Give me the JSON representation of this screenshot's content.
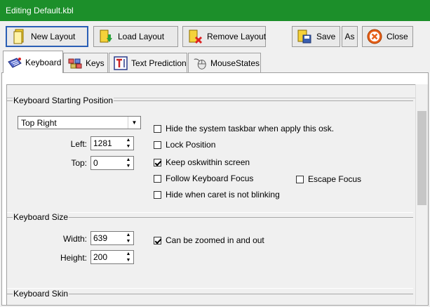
{
  "window": {
    "title": "Editing Default.kbl"
  },
  "toolbar": {
    "new_layout": "New Layout",
    "load_layout": "Load Layout",
    "remove_layout": "Remove Layout",
    "save": "Save",
    "save_as": "As",
    "close": "Close"
  },
  "tabs": [
    {
      "label": "Keyboard",
      "icon": "keyboard-icon",
      "selected": true
    },
    {
      "label": "Keys",
      "icon": "keys-icon",
      "selected": false
    },
    {
      "label": "Text Prediction",
      "icon": "text-prediction-icon",
      "selected": false
    },
    {
      "label": "MouseStates",
      "icon": "mouse-icon",
      "selected": false
    }
  ],
  "position": {
    "title": "Keyboard Starting Position",
    "dropdown_value": "Top Right",
    "left_label": "Left:",
    "left_value": "1281",
    "top_label": "Top:",
    "top_value": "0",
    "options": [
      {
        "label": "Hide the system taskbar when apply this osk.",
        "checked": false
      },
      {
        "label": "Lock Position",
        "checked": false
      },
      {
        "label": "Keep oskwithin screen",
        "checked": true
      },
      {
        "label": "Follow Keyboard Focus",
        "checked": false
      },
      {
        "label": "Hide when caret is not blinking",
        "checked": false
      }
    ],
    "escape_focus": {
      "label": "Escape Focus",
      "checked": false
    }
  },
  "size": {
    "title": "Keyboard Size",
    "width_label": "Width:",
    "width_value": "639",
    "height_label": "Height:",
    "height_value": "200",
    "zoom": {
      "label": "Can be zoomed in and out",
      "checked": true
    }
  },
  "skin": {
    "title": "Keyboard Skin"
  },
  "colors": {
    "titlebar": "#1c8f2a",
    "focus_border": "#2b5fb5"
  }
}
